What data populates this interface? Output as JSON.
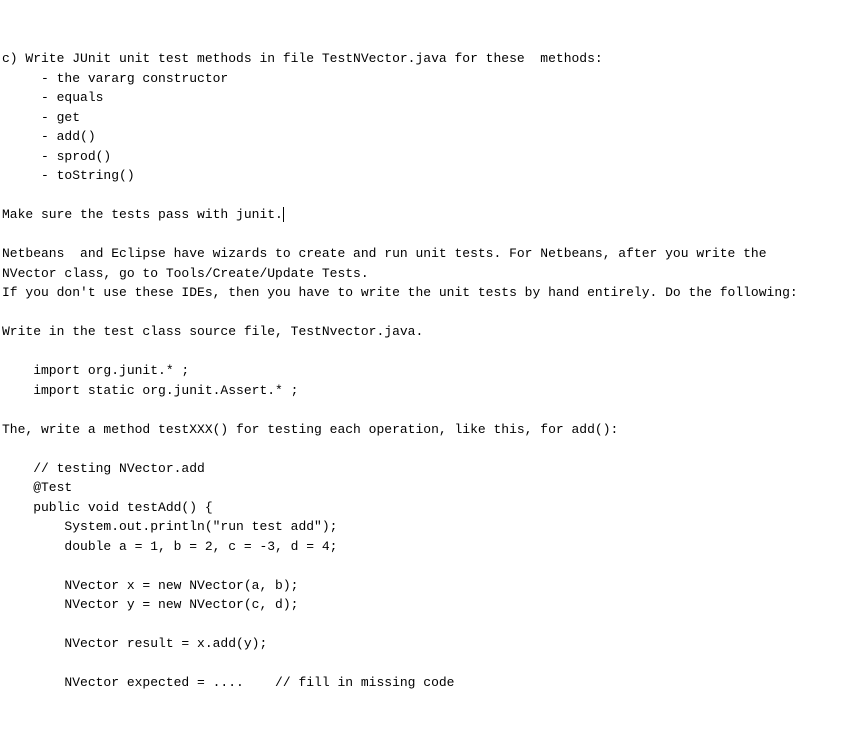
{
  "line1": "c) Write JUnit unit test methods in file TestNVector.java for these  methods:",
  "line2": "     - the vararg constructor",
  "line3": "     - equals",
  "line4": "     - get",
  "line5": "     - add()",
  "line6": "     - sprod()",
  "line7": "     - toString()",
  "line8": "",
  "line9a": "Make sure the tests pass with junit.",
  "line10": "",
  "line11": "Netbeans  and Eclipse have wizards to create and run unit tests. For Netbeans, after you write the",
  "line12": "NVector class, go to Tools/Create/Update Tests.",
  "line13": "If you don't use these IDEs, then you have to write the unit tests by hand entirely. Do the following:",
  "line14": "",
  "line15": "Write in the test class source file, TestNvector.java.",
  "line16": "",
  "line17": "    import org.junit.* ;",
  "line18": "    import static org.junit.Assert.* ;",
  "line19": "",
  "line20": "The, write a method testXXX() for testing each operation, like this, for add():",
  "line21": "",
  "line22": "    // testing NVector.add",
  "line23": "    @Test",
  "line24": "    public void testAdd() {",
  "line25": "        System.out.println(\"run test add\");",
  "line26": "        double a = 1, b = 2, c = -3, d = 4;",
  "line27": "",
  "line28": "        NVector x = new NVector(a, b);",
  "line29": "        NVector y = new NVector(c, d);",
  "line30": "",
  "line31": "        NVector result = x.add(y);",
  "line32": "",
  "line33": "        NVector expected = ....    // fill in missing code"
}
